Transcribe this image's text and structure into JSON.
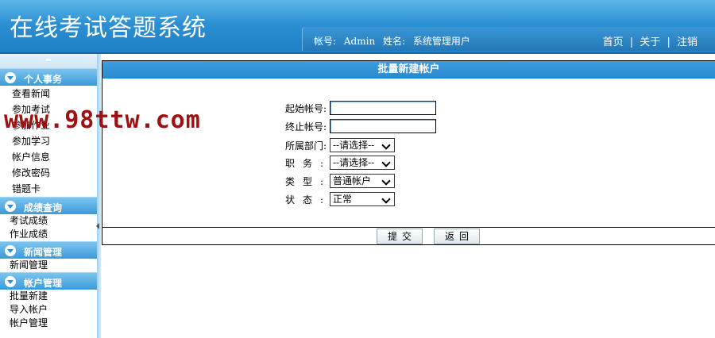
{
  "header": {
    "app_title": "在线考试答题系统",
    "account_label": "帐号:",
    "account_value": "Admin",
    "name_label": "姓名:",
    "name_value": "系统管理用户",
    "links": {
      "home": "首页",
      "about": "关于",
      "logout": "注销",
      "separator": "|"
    }
  },
  "sidebar": {
    "sections": [
      {
        "title": "个人事务",
        "items": [
          "查看新闻",
          "参加考试",
          "参加作业",
          "参加学习",
          "帐户信息",
          "修改密码",
          "错题卡"
        ]
      },
      {
        "title": "成绩查询",
        "items": [
          "考试成绩",
          "作业成绩"
        ]
      },
      {
        "title": "新闻管理",
        "items": [
          "新闻管理"
        ]
      },
      {
        "title": "帐户管理",
        "items": [
          "批量新建",
          "导入帐户",
          "帐户管理"
        ]
      }
    ]
  },
  "main": {
    "title": "批量新建帐户",
    "form": {
      "start_account_label": "起始帐号:",
      "start_account_value": "",
      "end_account_label": "终止帐号:",
      "end_account_value": "",
      "department_label": "所属部门:",
      "department_value": "--请选择--",
      "position_label": "职务:",
      "position_value": "--请选择--",
      "type_label": "类型:",
      "type_value": "普通帐户",
      "status_label": "状态:",
      "status_value": "正常"
    },
    "buttons": {
      "submit": "提交",
      "back": "返回"
    }
  },
  "watermark": "www.98ttw.com",
  "colors": {
    "header_blue": "#2a8fd2",
    "section_blue": "#3b9ad8",
    "watermark_red": "#a01010"
  }
}
